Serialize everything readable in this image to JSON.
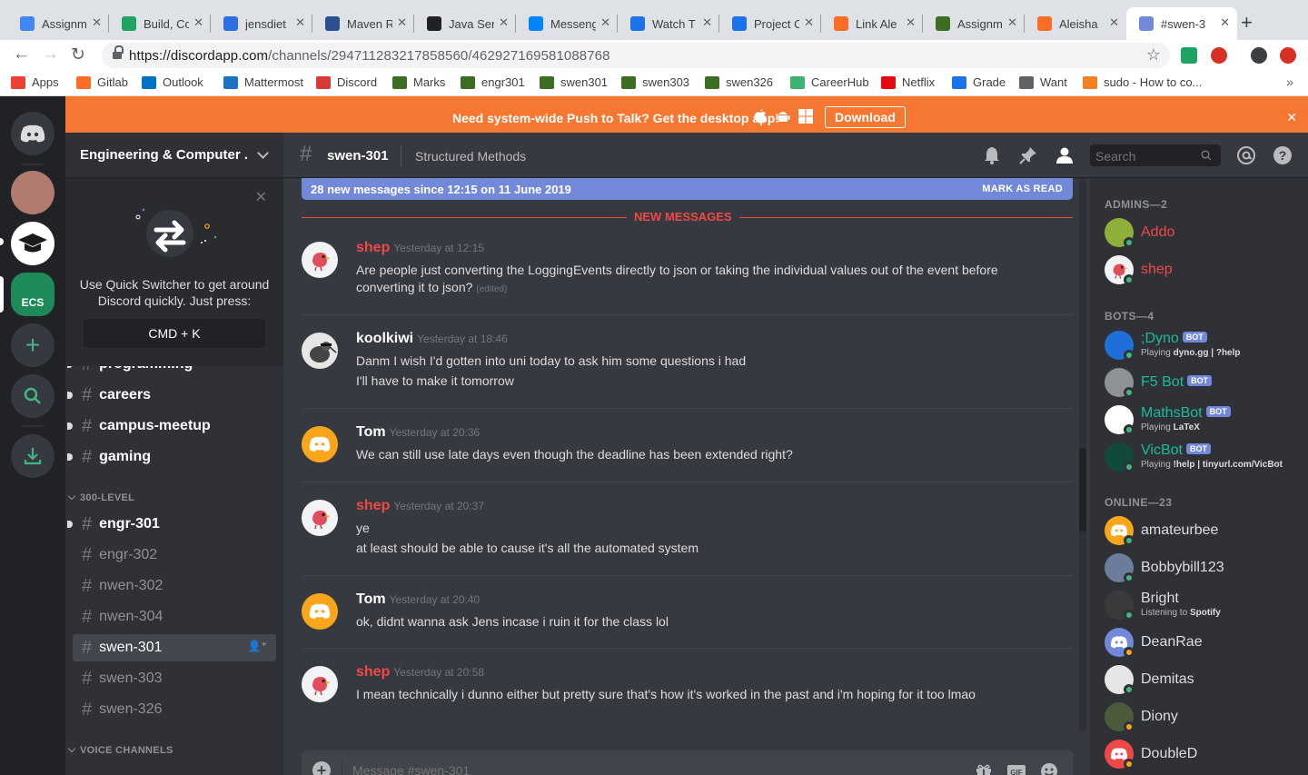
{
  "browser": {
    "tabs": [
      {
        "title": "Assignment",
        "color": "#4285f4"
      },
      {
        "title": "Build, Co",
        "color": "#1ea362"
      },
      {
        "title": "jensdiet",
        "color": "#2d6ee0"
      },
      {
        "title": "Maven R",
        "color": "#2b4f8f"
      },
      {
        "title": "Java Ser",
        "color": "#202124"
      },
      {
        "title": "Messenger",
        "color": "#0084ff"
      },
      {
        "title": "Watch T",
        "color": "#1a73e8"
      },
      {
        "title": "Project C",
        "color": "#1a73e8"
      },
      {
        "title": "Link Ale",
        "color": "#fc6d26"
      },
      {
        "title": "Assignm",
        "color": "#3b6e22"
      },
      {
        "title": "Aleisha",
        "color": "#fc6d26"
      },
      {
        "title": "#swen-3",
        "color": "#7289da"
      }
    ],
    "url_host": "https://discordapp.com",
    "url_path": "/channels/294711283217858560/462927169581088768",
    "bookmarks": [
      {
        "label": "Apps",
        "color": "#ea4335"
      },
      {
        "label": "Gitlab",
        "color": "#fc6d26"
      },
      {
        "label": "Outlook",
        "color": "#0072c6"
      },
      {
        "label": "Mattermost",
        "color": "#1e72c2"
      },
      {
        "label": "Discord",
        "color": "#d83a3a"
      },
      {
        "label": "Marks",
        "color": "#3b6e22"
      },
      {
        "label": "engr301",
        "color": "#3b6e22"
      },
      {
        "label": "swen301",
        "color": "#3b6e22"
      },
      {
        "label": "swen303",
        "color": "#3b6e22"
      },
      {
        "label": "swen326",
        "color": "#3b6e22"
      },
      {
        "label": "CareerHub",
        "color": "#3cb371"
      },
      {
        "label": "Netflix",
        "color": "#e50914"
      },
      {
        "label": "Grade",
        "color": "#1a73e8"
      },
      {
        "label": "Want",
        "color": "#5f6368"
      },
      {
        "label": "sudo - How to co...",
        "color": "#f48024"
      }
    ]
  },
  "banner": {
    "text": "Need system-wide Push to Talk? Get the desktop app!",
    "download": "Download",
    "close": "✕"
  },
  "server": {
    "name": "Engineering & Computer ...",
    "quick_switcher": {
      "text": "Use Quick Switcher to get around Discord quickly. Just press:",
      "shortcut": "CMD + K"
    },
    "channels_top": [
      {
        "name": "programming",
        "state": "unread"
      },
      {
        "name": "careers",
        "state": "unread"
      },
      {
        "name": "campus-meetup",
        "state": "unread"
      },
      {
        "name": "gaming",
        "state": "unread"
      }
    ],
    "category_300": "300-LEVEL",
    "channels_300": [
      {
        "name": "engr-301",
        "state": "unread"
      },
      {
        "name": "engr-302",
        "state": "read"
      },
      {
        "name": "nwen-302",
        "state": "read"
      },
      {
        "name": "nwen-304",
        "state": "read"
      },
      {
        "name": "swen-301",
        "state": "selected"
      },
      {
        "name": "swen-303",
        "state": "read"
      },
      {
        "name": "swen-326",
        "state": "read"
      }
    ],
    "category_voice": "VOICE CHANNELS"
  },
  "channel": {
    "name": "swen-301",
    "topic": "Structured Methods",
    "search_placeholder": "Search"
  },
  "new_messages": {
    "bar_text": "28 new messages since 12:15 on 11 June 2019",
    "mark_read": "MARK AS READ",
    "divider": "NEW MESSAGES"
  },
  "messages": [
    {
      "author": "shep",
      "color": "#f04747",
      "time": "Yesterday at 12:15",
      "avatar": "bird",
      "lines": [
        "Are people just converting the LoggingEvents directly to json or taking the individual values out of the event before converting it to json?"
      ],
      "edited": "(edited)"
    },
    {
      "author": "koolkiwi",
      "color": "#ffffff",
      "time": "Yesterday at 18:46",
      "avatar": "kiwi",
      "lines": [
        "Danm I wish I'd gotten into uni today to ask him some questions i had",
        "I'll have to make it tomorrow"
      ]
    },
    {
      "author": "Tom",
      "color": "#ffffff",
      "time": "Yesterday at 20:36",
      "avatar": "discord-yellow",
      "lines": [
        "We can still use late days even though the deadline has been extended right?"
      ]
    },
    {
      "author": "shep",
      "color": "#f04747",
      "time": "Yesterday at 20:37",
      "avatar": "bird",
      "lines": [
        "ye",
        "at least should be able to cause it's all the automated system"
      ]
    },
    {
      "author": "Tom",
      "color": "#ffffff",
      "time": "Yesterday at 20:40",
      "avatar": "discord-yellow",
      "lines": [
        "ok, didnt wanna ask Jens incase i ruin it for the class lol"
      ]
    },
    {
      "author": "shep",
      "color": "#f04747",
      "time": "Yesterday at 20:58",
      "avatar": "bird",
      "lines": [
        "I mean technically i dunno either but pretty sure that's how it's worked in the past and i'm hoping for it too lmao"
      ]
    }
  ],
  "composer": {
    "placeholder": "Message #swen-301"
  },
  "members": {
    "admins_label": "ADMINS—2",
    "admins": [
      {
        "name": "Addo",
        "color": "#f04747"
      },
      {
        "name": "shep",
        "color": "#f04747"
      }
    ],
    "bots_label": "BOTS—4",
    "bots": [
      {
        "name": ";Dyno",
        "color": "#1abc9c",
        "badge": "BOT",
        "activity_prefix": "Playing",
        "activity": "dyno.gg | ?help"
      },
      {
        "name": "F5 Bot",
        "color": "#1abc9c",
        "badge": "BOT",
        "activity_prefix": "",
        "activity": ""
      },
      {
        "name": "MathsBot",
        "color": "#1abc9c",
        "badge": "BOT",
        "activity_prefix": "Playing",
        "activity": "LaTeX"
      },
      {
        "name": "VicBot",
        "color": "#1abc9c",
        "badge": "BOT",
        "activity_prefix": "Playing",
        "activity": "!help | tinyurl.com/VicBot"
      }
    ],
    "online_label": "ONLINE—23",
    "online": [
      {
        "name": "amateurbee",
        "activity_prefix": "",
        "activity": ""
      },
      {
        "name": "Bobbybill123",
        "activity_prefix": "",
        "activity": ""
      },
      {
        "name": "Bright",
        "activity_prefix": "Listening to",
        "activity": "Spotify"
      },
      {
        "name": "DeanRae",
        "activity_prefix": "",
        "activity": ""
      },
      {
        "name": "Demitas",
        "activity_prefix": "",
        "activity": ""
      },
      {
        "name": "Diony",
        "activity_prefix": "",
        "activity": ""
      },
      {
        "name": "DoubleD",
        "activity_prefix": "",
        "activity": ""
      }
    ]
  }
}
